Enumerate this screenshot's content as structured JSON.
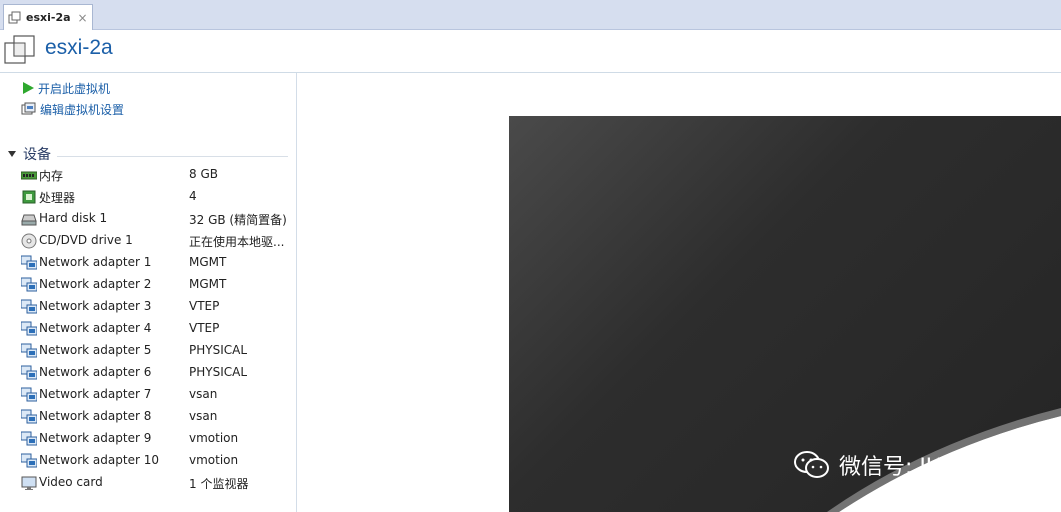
{
  "tab": {
    "label": "esxi-2a",
    "close": "×"
  },
  "header": {
    "title": "esxi-2a"
  },
  "actions": {
    "power_on": "开启此虚拟机",
    "edit_settings": "编辑虚拟机设置"
  },
  "devices": {
    "section_title": "设备",
    "rows": [
      {
        "name": "内存",
        "value": "8 GB",
        "icon": "memory-icon"
      },
      {
        "name": "处理器",
        "value": "4",
        "icon": "processor-icon"
      },
      {
        "name": "Hard disk 1",
        "value": "32 GB (精简置备)",
        "icon": "hard-disk-icon"
      },
      {
        "name": "CD/DVD drive 1",
        "value": "正在使用本地驱...",
        "icon": "cd-dvd-icon"
      },
      {
        "name": "Network adapter 1",
        "value": "MGMT",
        "icon": "network-adapter-icon"
      },
      {
        "name": "Network adapter 2",
        "value": "MGMT",
        "icon": "network-adapter-icon"
      },
      {
        "name": "Network adapter 3",
        "value": "VTEP",
        "icon": "network-adapter-icon"
      },
      {
        "name": "Network adapter 4",
        "value": "VTEP",
        "icon": "network-adapter-icon"
      },
      {
        "name": "Network adapter 5",
        "value": "PHYSICAL",
        "icon": "network-adapter-icon"
      },
      {
        "name": "Network adapter 6",
        "value": "PHYSICAL",
        "icon": "network-adapter-icon"
      },
      {
        "name": "Network adapter 7",
        "value": "vsan",
        "icon": "network-adapter-icon"
      },
      {
        "name": "Network adapter 8",
        "value": "vsan",
        "icon": "network-adapter-icon"
      },
      {
        "name": "Network adapter 9",
        "value": "vmotion",
        "icon": "network-adapter-icon"
      },
      {
        "name": "Network adapter 10",
        "value": "vmotion",
        "icon": "network-adapter-icon"
      },
      {
        "name": "Video card",
        "value": "1 个监视器",
        "icon": "video-card-icon"
      }
    ]
  },
  "watermark": {
    "text": "微信号: JUJUXV"
  },
  "colors": {
    "accent": "#1b5fa8",
    "tabstrip": "#d6deef",
    "console": "#2d2d2d"
  }
}
